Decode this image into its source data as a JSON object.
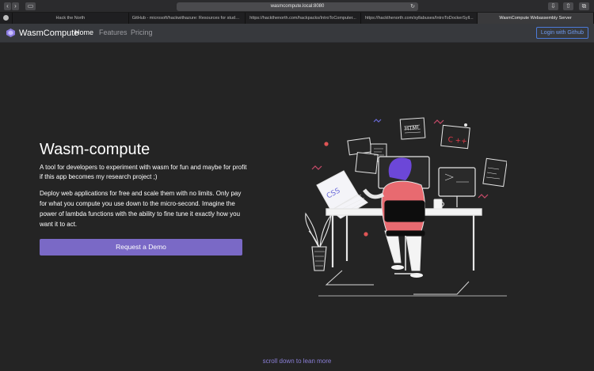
{
  "browser": {
    "url": "wasmcompute.local:8080",
    "tabs": [
      {
        "label": ""
      },
      {
        "label": "Hack the North"
      },
      {
        "label": "GitHub - microsoft/hackwithazure: Resources for stude..."
      },
      {
        "label": "https://hackthenorth.com/hackpacks/IntroToComputer..."
      },
      {
        "label": "https://hackthenorth.com/syllabuses/IntroToDockerSyll..."
      },
      {
        "label": "WasmCompute Webassembly Server"
      }
    ]
  },
  "nav": {
    "brand": "WasmCompute",
    "links": [
      "Home",
      "Features",
      "Pricing"
    ],
    "login": "Login with Github"
  },
  "hero": {
    "title": "Wasm-compute",
    "p1": "A tool for developers to experiment with wasm for fun and maybe for profit if this app becomes my research project ;)",
    "p2": "Deploy web applications for free and scale them with no limits. Only pay for what you compute you use down to the micro-second. Imagine the power of lambda functions with the ability to fine tune it exactly how you want it to act.",
    "cta": "Request a Demo"
  },
  "illustration": {
    "labels": [
      "HTML",
      "C ++",
      "CSS"
    ]
  },
  "footer": {
    "scroll_hint": "scroll down to lean more"
  },
  "colors": {
    "background": "#242424",
    "nav": "#37393d",
    "accent": "#7a69c6",
    "link_blue": "#6e9af0"
  }
}
